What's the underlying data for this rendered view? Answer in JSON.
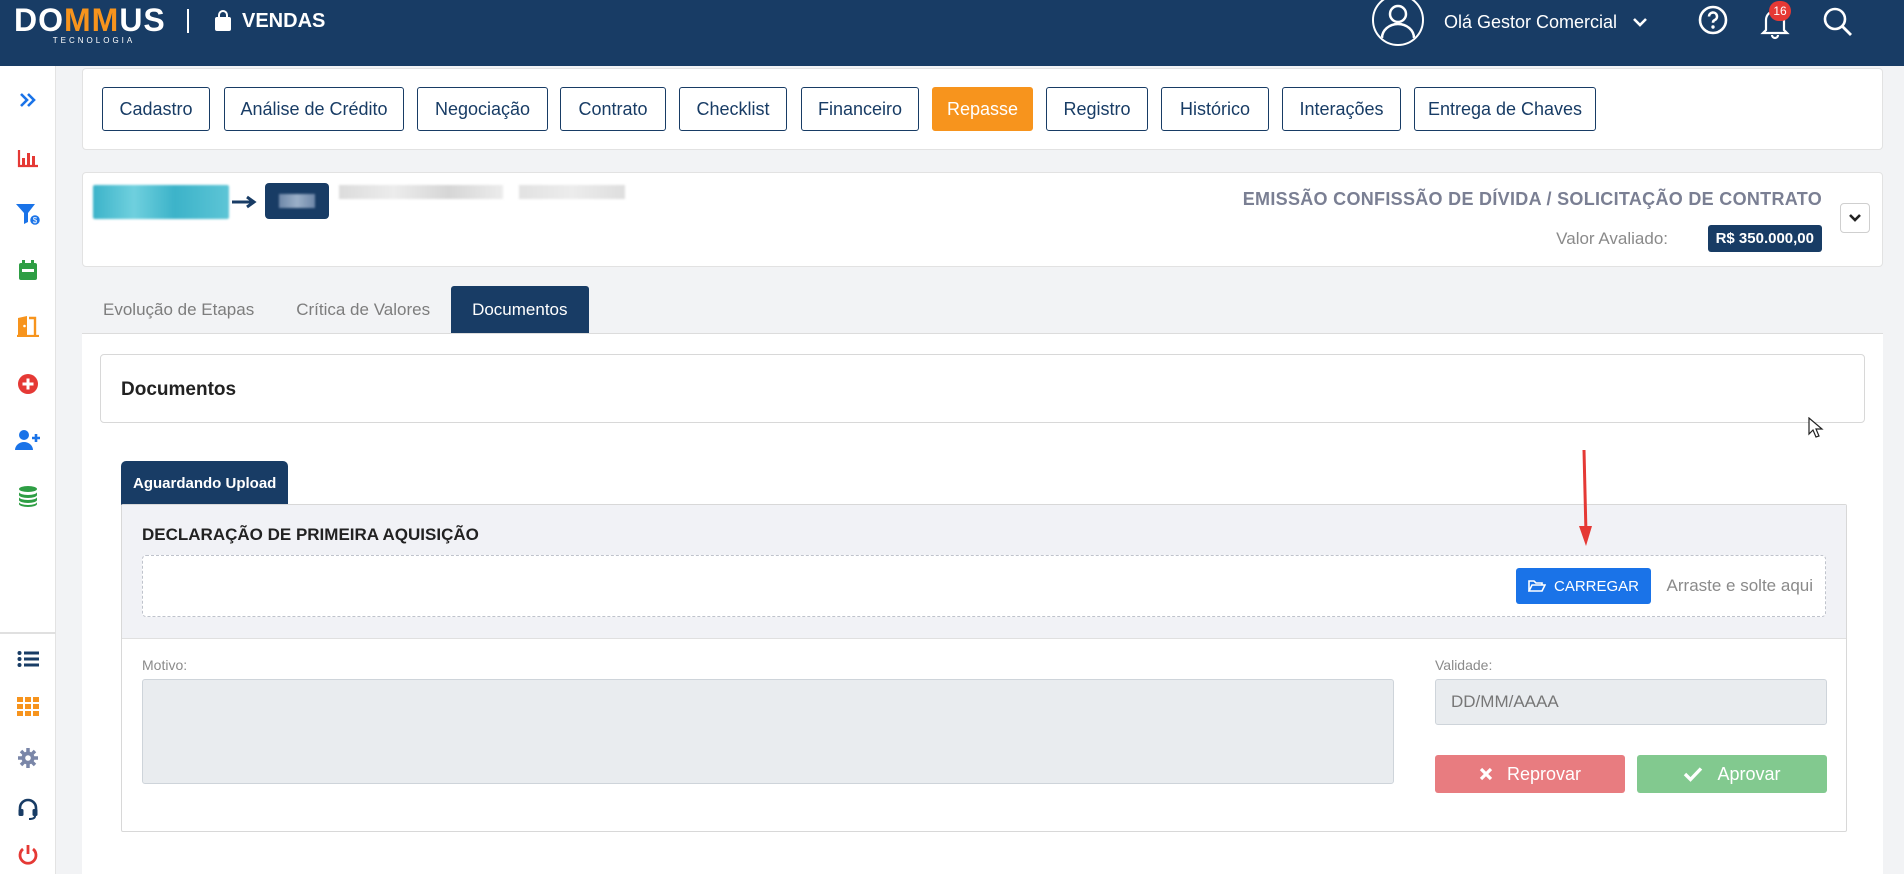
{
  "app": {
    "logo_prefix": "DO",
    "logo_mm": "MM",
    "logo_suffix": "US",
    "logo_sub": "TECNOLOGIA",
    "module": "VENDAS",
    "greeting": "Olá Gestor Comercial",
    "notifications": "16"
  },
  "sidebar": {
    "items": [
      {
        "icon": "double-chevron-right-icon",
        "color": "#1a73e8"
      },
      {
        "icon": "bar-chart-icon",
        "color": "#e53935"
      },
      {
        "icon": "filter-money-icon",
        "color": "#1a73e8"
      },
      {
        "icon": "calendar-icon",
        "color": "#2e9e44"
      },
      {
        "icon": "door-icon",
        "color": "#f7941d"
      },
      {
        "icon": "plus-circle-icon",
        "color": "#e53935"
      },
      {
        "icon": "user-plus-icon",
        "color": "#1a73e8"
      },
      {
        "icon": "coins-icon",
        "color": "#2e9e44"
      },
      {
        "icon": "list-icon",
        "color": "#183c65"
      },
      {
        "icon": "grid-icon",
        "color": "#f7941d"
      },
      {
        "icon": "gear-icon",
        "color": "#7a86a8"
      },
      {
        "icon": "headset-icon",
        "color": "#183c65"
      },
      {
        "icon": "power-icon",
        "color": "#e53935"
      }
    ]
  },
  "stages": [
    {
      "label": "Cadastro",
      "active": false
    },
    {
      "label": "Análise de Crédito",
      "active": false
    },
    {
      "label": "Negociação",
      "active": false
    },
    {
      "label": "Contrato",
      "active": false
    },
    {
      "label": "Checklist",
      "active": false
    },
    {
      "label": "Financeiro",
      "active": false
    },
    {
      "label": "Repasse",
      "active": true
    },
    {
      "label": "Registro",
      "active": false
    },
    {
      "label": "Histórico",
      "active": false
    },
    {
      "label": "Interações",
      "active": false
    },
    {
      "label": "Entrega de Chaves",
      "active": false
    }
  ],
  "process": {
    "title": "EMISSÃO CONFISSÃO DE DÍVIDA / SOLICITAÇÃO DE CONTRATO",
    "valor_label": "Valor Avaliado:",
    "valor": "R$ 350.000,00"
  },
  "subtabs": [
    {
      "label": "Evolução de Etapas",
      "active": false
    },
    {
      "label": "Crítica de Valores",
      "active": false
    },
    {
      "label": "Documentos",
      "active": true
    }
  ],
  "documents": {
    "title": "Documentos",
    "status_tab": "Aguardando Upload",
    "doc_name": "DECLARAÇÃO DE PRIMEIRA AQUISIÇÃO",
    "upload_label": "CARREGAR",
    "drop_hint": "Arraste e solte aqui",
    "motivo_label": "Motivo:",
    "validade_label": "Validade:",
    "validade_placeholder": "DD/MM/AAAA",
    "reprovar_label": "Reprovar",
    "aprovar_label": "Aprovar"
  },
  "colors": {
    "navy": "#183c65",
    "orange": "#f7941d",
    "blue": "#1a73e8",
    "reprovar": "#e87c80",
    "aprovar": "#82c98f"
  }
}
